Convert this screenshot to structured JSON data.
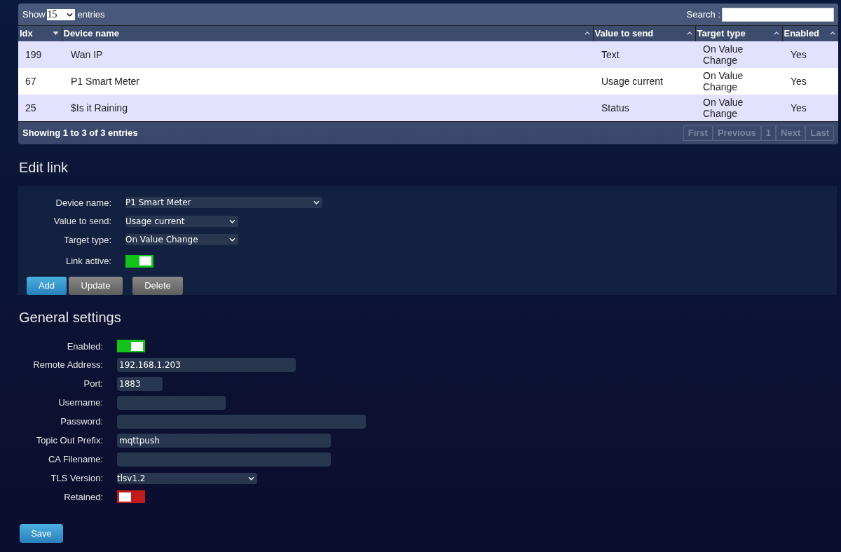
{
  "table": {
    "length_label_before": "Show",
    "length_value": "15",
    "length_label_after": "entries",
    "search_label": "Search :",
    "columns": [
      {
        "label": "Idx",
        "sorted": true
      },
      {
        "label": "Device name",
        "sorted": false
      },
      {
        "label": "Value to send",
        "sorted": false
      },
      {
        "label": "Target type",
        "sorted": false
      },
      {
        "label": "Enabled",
        "sorted": false
      }
    ],
    "rows": [
      [
        "199",
        "Wan IP",
        "Text",
        "On Value Change",
        "Yes"
      ],
      [
        "67",
        "P1 Smart Meter",
        "Usage current",
        "On Value Change",
        "Yes"
      ],
      [
        "25",
        "$Is it Raining",
        "Status",
        "On Value Change",
        "Yes"
      ]
    ],
    "info": "Showing 1 to 3 of 3 entries",
    "pagination": [
      {
        "label": "First",
        "disabled": true
      },
      {
        "label": "Previous",
        "disabled": true
      },
      {
        "label": "1",
        "disabled": true
      },
      {
        "label": "Next",
        "disabled": true
      },
      {
        "label": "Last",
        "disabled": true
      }
    ]
  },
  "edit_link": {
    "title": "Edit link",
    "fields": [
      {
        "kind": "select",
        "label": "Device name:",
        "value": "P1 Smart Meter"
      },
      {
        "kind": "select",
        "label": "Value to send:",
        "value": "Usage current"
      },
      {
        "kind": "select",
        "label": "Target type:",
        "value": "On Value Change"
      },
      {
        "kind": "toggle",
        "label": "Link active:",
        "on": true
      }
    ],
    "buttons": [
      "Add",
      "Update",
      "Delete"
    ]
  },
  "general_settings": {
    "title": "General settings",
    "fields": [
      {
        "kind": "toggle",
        "label": "Enabled:",
        "on": true
      },
      {
        "kind": "text",
        "label": "Remote Address:",
        "value": "192.168.1.203"
      },
      {
        "kind": "text",
        "label": "Port:",
        "value": "1883"
      },
      {
        "kind": "text",
        "label": "Username:"
      },
      {
        "kind": "text",
        "label": "Password:"
      },
      {
        "kind": "text",
        "label": "Topic Out Prefix:",
        "value": "mqttpush"
      },
      {
        "kind": "text",
        "label": "CA Filename:"
      },
      {
        "kind": "select",
        "label": "TLS Version:",
        "value": "tlsv1.2"
      },
      {
        "kind": "toggle",
        "label": "Retained:",
        "on": false
      }
    ],
    "save_button": "Save"
  }
}
